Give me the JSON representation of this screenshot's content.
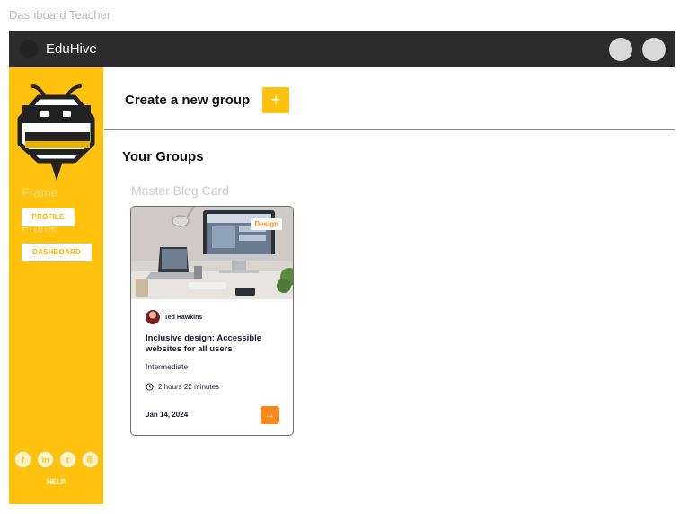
{
  "frame_label": "Dashboard Teacher",
  "topbar": {
    "title": "EduHive"
  },
  "sidebar": {
    "frame_ghost": "Frame",
    "profile_label": "PROFILE",
    "dashboard_label": "DASHBOARD",
    "social": [
      "f",
      "in",
      "t",
      "◎"
    ],
    "help_label": "HELP"
  },
  "main": {
    "create_title": "Create a new group",
    "add_symbol": "+",
    "groups_title": "Your Groups",
    "card_label": "Master Blog Card"
  },
  "card": {
    "tag": "Design",
    "author": "Ted Hawkins",
    "title": "Inclusive design: Accessible websites for all users",
    "level": "Intermediate",
    "duration": "2 hours 22 minutes",
    "date": "Jan 14, 2024",
    "arrow": "→"
  },
  "colors": {
    "brand": "#ffc20e",
    "accent": "#f58a1f",
    "topbar": "#2c2c2c"
  }
}
